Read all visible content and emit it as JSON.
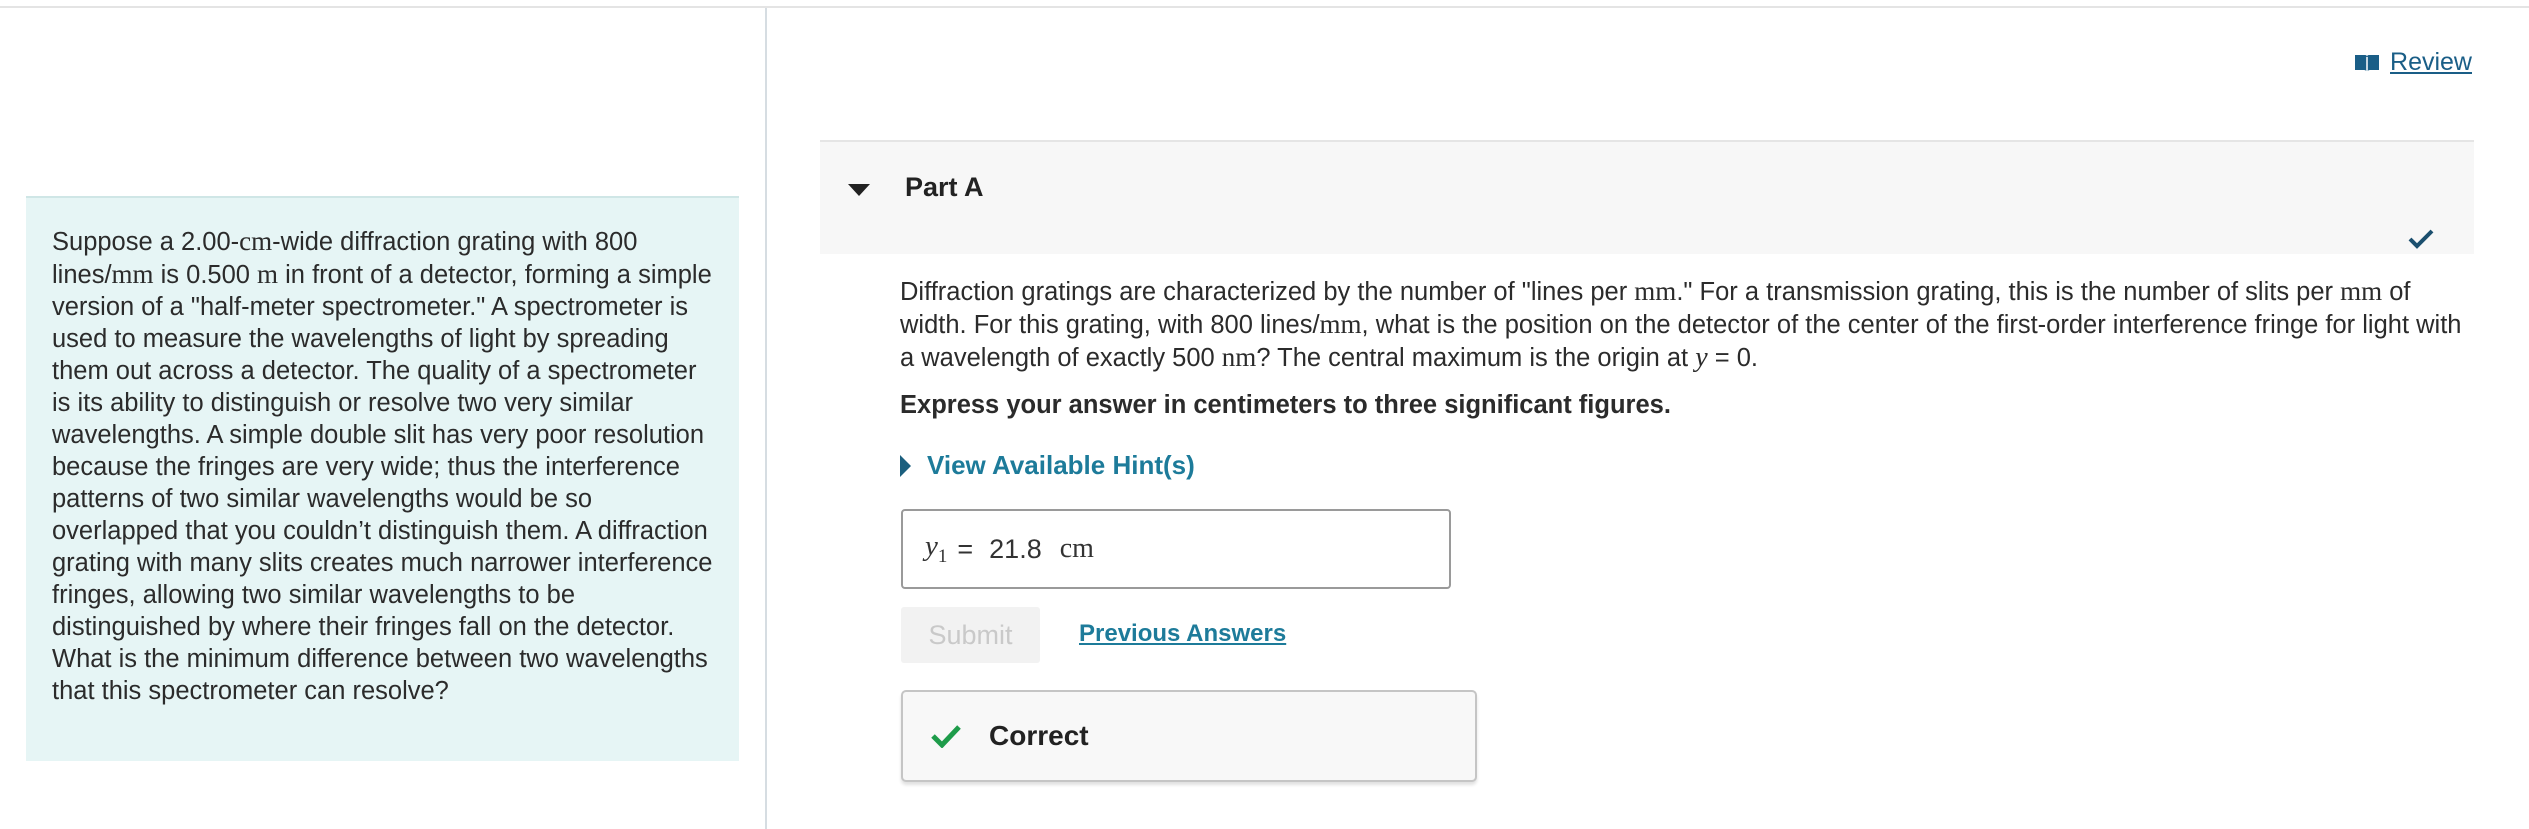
{
  "review_link": "Review",
  "problem": {
    "parts": [
      "Suppose a 2.00-",
      "cm",
      "-wide diffraction grating with 800 lines/",
      "mm",
      " is 0.500 ",
      "m",
      " in front of a detector, forming a simple version of a \"half-meter spectrometer.\" A spectrometer is used to measure the wavelengths of light by spreading them out across a detector. The quality of a spectrometer is its ability to distinguish or resolve two very similar wavelengths. A simple double slit has very poor resolution because the fringes are very wide; thus the interference patterns of two similar wavelengths would be so overlapped that you couldn’t distinguish them. A diffraction grating with many slits creates much narrower interference fringes, allowing two similar wavelengths to be distinguished by where their fringes fall on the detector. What is the minimum difference between two wavelengths that this spectrometer can resolve?"
    ]
  },
  "part": {
    "title": "Part A",
    "question_parts": [
      "Diffraction gratings are characterized by the number of \"lines per ",
      "mm",
      ".\" For a transmission grating, this is the number of slits per ",
      "mm",
      " of width. For this grating, with 800 lines/",
      "mm",
      ", what is the position on the detector of the center of the first-order interference fringe for light with a wavelength of exactly 500 ",
      "nm",
      "? The central maximum is the origin at ",
      "y",
      " = 0."
    ],
    "instruction": "Express your answer in centimeters to three significant figures.",
    "hint_label": "View Available Hint(s)",
    "answer": {
      "variable": "y",
      "subscript": "1",
      "equals": "=",
      "value": "21.8",
      "unit": "cm"
    },
    "submit_label": "Submit",
    "previous_answers_label": "Previous Answers",
    "feedback": "Correct"
  },
  "colors": {
    "accent": "#1d7b9a",
    "link": "#1a5e87",
    "correct_green": "#1e9c4a",
    "check_navy": "#1b4f6e",
    "problem_bg": "#e6f5f5"
  },
  "icons": {
    "review": "book-icon",
    "part_status": "checkmark-icon",
    "hint": "caret-right-icon",
    "collapse": "caret-down-icon",
    "feedback": "checkmark-icon"
  }
}
